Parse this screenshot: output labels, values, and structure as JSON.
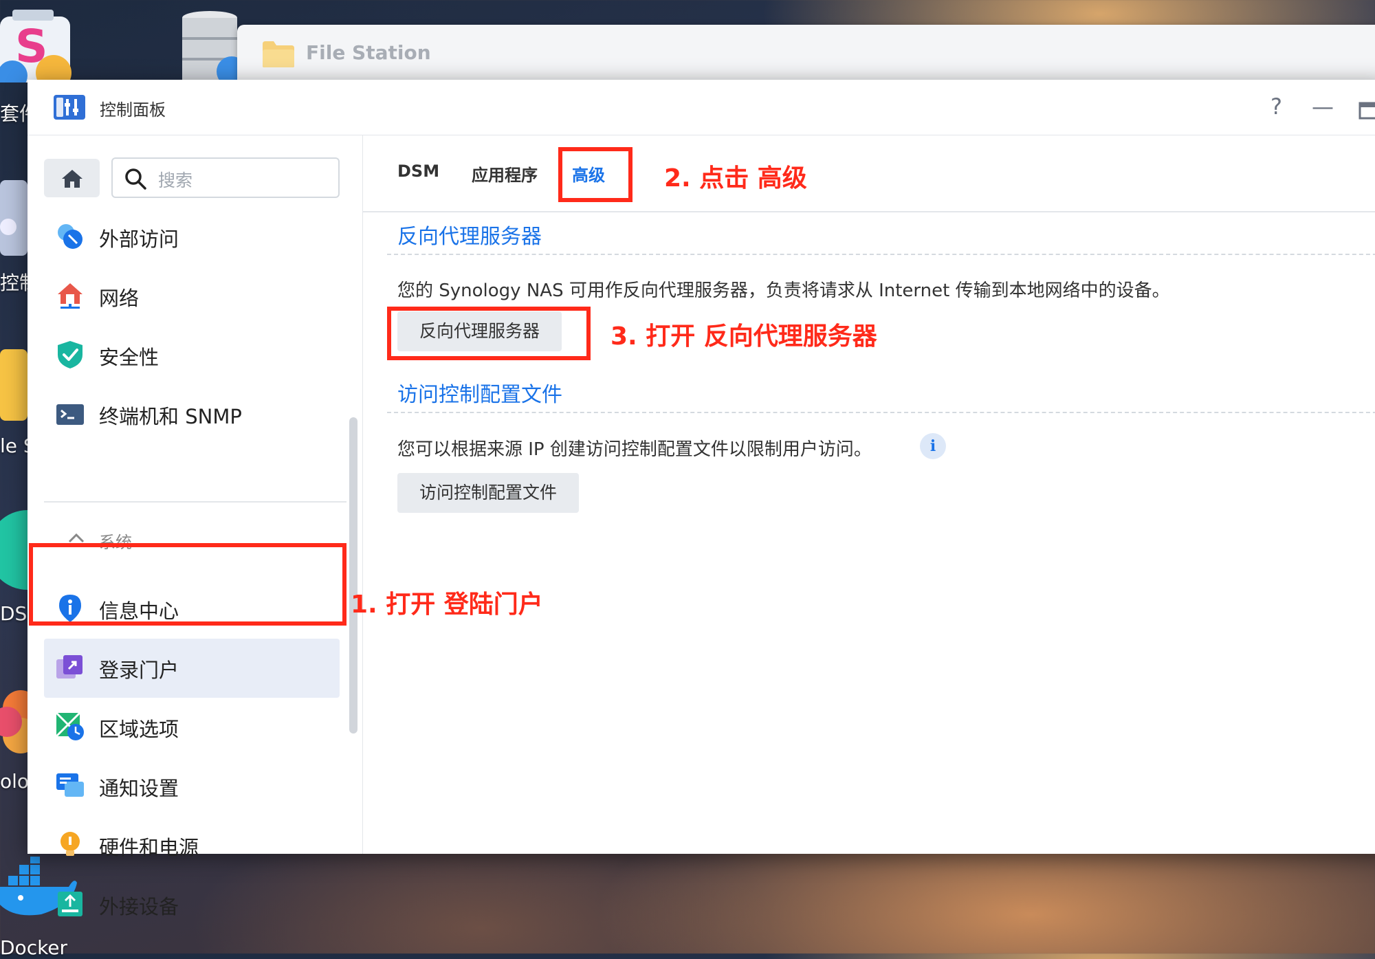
{
  "desktop": {
    "labels": [
      "套件",
      "控制",
      "le S",
      "DSM",
      "olog",
      "Docker"
    ]
  },
  "file_station": {
    "title": "File Station"
  },
  "window": {
    "title": "控制面板",
    "help_label": "?",
    "minimize_label": "—"
  },
  "sidebar": {
    "search_placeholder": "搜索",
    "items_top": [
      {
        "label": "外部访问",
        "icon": "external-access-icon"
      },
      {
        "label": "网络",
        "icon": "network-icon"
      },
      {
        "label": "安全性",
        "icon": "shield-icon"
      },
      {
        "label": "终端机和 SNMP",
        "icon": "terminal-icon"
      }
    ],
    "section_label": "系统",
    "items_system": [
      {
        "label": "信息中心",
        "icon": "info-center-icon"
      },
      {
        "label": "登录门户",
        "icon": "login-portal-icon",
        "active": true
      },
      {
        "label": "区域选项",
        "icon": "regional-options-icon"
      },
      {
        "label": "通知设置",
        "icon": "notification-icon"
      },
      {
        "label": "硬件和电源",
        "icon": "bulb-icon"
      },
      {
        "label": "外接设备",
        "icon": "external-device-icon"
      }
    ]
  },
  "tabs": [
    {
      "label": "DSM"
    },
    {
      "label": "应用程序"
    },
    {
      "label": "高级",
      "active": true
    }
  ],
  "reverse_proxy": {
    "title": "反向代理服务器",
    "description": "您的 Synology NAS 可用作反向代理服务器，负责将请求从 Internet 传输到本地网络中的设备。",
    "button": "反向代理服务器"
  },
  "access_control": {
    "title": "访问控制配置文件",
    "description": "您可以根据来源 IP 创建访问控制配置文件以限制用户访问。",
    "info_label": "i",
    "button": "访问控制配置文件"
  },
  "annotations": {
    "step1": "1. 打开 登陆门户",
    "step2": "2. 点击 高级",
    "step3": "3. 打开 反向代理服务器"
  },
  "colors": {
    "accent": "#1a73e8",
    "annotation": "#ff2a1a"
  }
}
